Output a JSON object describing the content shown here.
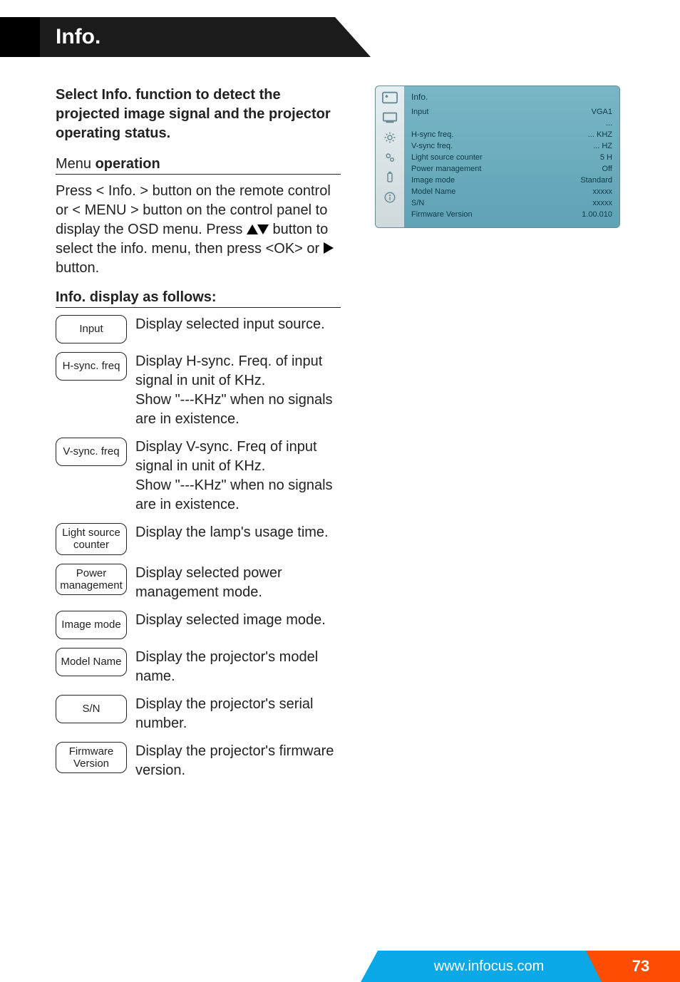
{
  "header": {
    "title": "Info."
  },
  "intro": "Select Info. function to detect the projected image signal and the projector operating status.",
  "menu_heading_light": "Menu ",
  "menu_heading_bold": "operation",
  "menu_para_1": "Press < Info. > button on the remote control or < MENU > button on the control panel to display the OSD menu. Press ",
  "menu_para_2": " button to select the info. menu, then press <OK> or ",
  "menu_para_3": " button.",
  "info_heading": "Info. display as follows:",
  "info_rows": [
    {
      "label": "Input",
      "desc": "Display selected input source."
    },
    {
      "label": "H-sync. freq",
      "desc": "Display H-sync. Freq. of input signal in unit of KHz.\nShow \"---KHz\" when no signals are in existence."
    },
    {
      "label": "V-sync. freq",
      "desc": "Display V-sync. Freq of input signal in unit of KHz.\nShow \"---KHz\" when no signals are in existence."
    },
    {
      "label": "Light source counter",
      "desc": "Display the lamp's usage time."
    },
    {
      "label": "Power management",
      "desc": "Display selected power management mode."
    },
    {
      "label": "Image mode",
      "desc": "Display selected image mode."
    },
    {
      "label": "Model Name",
      "desc": "Display the projector's model name."
    },
    {
      "label": "S/N",
      "desc": "Display the projector's serial number."
    },
    {
      "label": "Firmware Version",
      "desc": "Display the projector's firmware version."
    }
  ],
  "osd": {
    "title": "Info.",
    "rows": [
      {
        "k": "Input",
        "v": "VGA1"
      },
      {
        "k": "",
        "v": "..."
      },
      {
        "k": "H-sync freq.",
        "v": "...   KHZ"
      },
      {
        "k": "V-sync freq.",
        "v": "...    HZ"
      },
      {
        "k": "Light source counter",
        "v": "5 H"
      },
      {
        "k": "Power management",
        "v": "Off"
      },
      {
        "k": "Image mode",
        "v": "Standard"
      },
      {
        "k": "Model Name",
        "v": "xxxxx"
      },
      {
        "k": "S/N",
        "v": "xxxxx"
      },
      {
        "k": "Firmware Version",
        "v": "1.00.010"
      }
    ]
  },
  "footer": {
    "url": "www.infocus.com",
    "page": "73"
  }
}
